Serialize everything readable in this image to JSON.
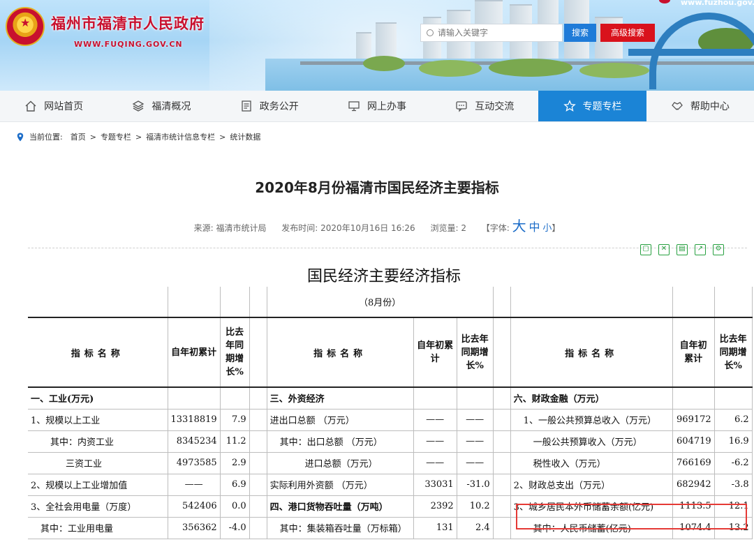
{
  "header": {
    "site_title": "福州市福清市人民政府",
    "site_url": "WWW.FUQING.GOV.CN",
    "top_right_url": "www.fuzhou.gov.cn",
    "search_placeholder": "请输入关键字",
    "search_button": "搜索",
    "advanced_search_button": "高级搜索"
  },
  "nav": {
    "items": [
      {
        "label": "网站首页",
        "icon": "home-icon",
        "active": false
      },
      {
        "label": "福清概况",
        "icon": "layers-icon",
        "active": false
      },
      {
        "label": "政务公开",
        "icon": "document-icon",
        "active": false
      },
      {
        "label": "网上办事",
        "icon": "monitor-icon",
        "active": false
      },
      {
        "label": "互动交流",
        "icon": "chat-icon",
        "active": false
      },
      {
        "label": "专题专栏",
        "icon": "star-icon",
        "active": true
      },
      {
        "label": "帮助中心",
        "icon": "handshake-icon",
        "active": false
      }
    ]
  },
  "breadcrumb": {
    "prefix": "当前位置:",
    "items": [
      "首页",
      "专题专栏",
      "福清市统计信息专栏",
      "统计数据"
    ],
    "separator": ">"
  },
  "article": {
    "title": "2020年8月份福清市国民经济主要指标",
    "source_label": "来源: 福清市统计局",
    "publish_label": "发布时间: 2020年10月16日 16:26",
    "views_label": "浏览量: 2",
    "font_prefix": "【字体:",
    "font_big": "大",
    "font_mid": "中",
    "font_small": "小",
    "font_suffix": "】"
  },
  "sheet": {
    "title": "国民经济主要经济指标",
    "month": "（8月份）",
    "header": {
      "name": "指标名称",
      "cumulative": "自年初累计",
      "growth3": "比去年同期增长%",
      "growth2": "比去年同期增长%"
    },
    "rows": [
      {
        "a_name": "一、工业(万元)",
        "a_val": "",
        "a_pct": "",
        "b_name": "三、外资经济",
        "b_val": "",
        "b_pct": "",
        "c_name": "六、财政金融（万元）",
        "c_val": "",
        "c_pct": ""
      },
      {
        "a_name": "1、规模以上工业",
        "a_val": "13318819",
        "a_pct": "7.9",
        "b_name": "进出口总额 （万元）",
        "b_val": "——",
        "b_pct": "——",
        "c_name": "1、一般公共预算总收入（万元）",
        "c_val": "969172",
        "c_pct": "6.2"
      },
      {
        "a_name": "其中：内资工业",
        "a_val": "8345234",
        "a_pct": "11.2",
        "b_name": "其中：出口总额 （万元）",
        "b_val": "——",
        "b_pct": "——",
        "c_name": "一般公共预算收入（万元）",
        "c_val": "604719",
        "c_pct": "16.9"
      },
      {
        "a_name": "三资工业",
        "a_val": "4973585",
        "a_pct": "2.9",
        "b_name": "进口总额（万元）",
        "b_val": "——",
        "b_pct": "——",
        "c_name": "税性收入（万元）",
        "c_val": "766169",
        "c_pct": "-6.2"
      },
      {
        "a_name": "2、规模以上工业增加值",
        "a_val": "——",
        "a_pct": "6.9",
        "b_name": "实际利用外资额 （万元）",
        "b_val": "33031",
        "b_pct": "-31.0",
        "c_name": "2、财政总支出（万元）",
        "c_val": "682942",
        "c_pct": "-3.8"
      },
      {
        "a_name": "3、全社会用电量（万度）",
        "a_val": "542406",
        "a_pct": "0.0",
        "b_name": "四、港口货物吞吐量（万吨）",
        "b_val": "2392",
        "b_pct": "10.2",
        "c_name": "3、城乡居民本外币储蓄余额(亿元)",
        "c_val": "1113.5",
        "c_pct": "12.1"
      },
      {
        "a_name": "其中：工业用电量",
        "a_val": "356362",
        "a_pct": "-4.0",
        "b_name": "其中：集装箱吞吐量（万标箱）",
        "b_val": "131",
        "b_pct": "2.4",
        "c_name": "其中：人民币储蓄(亿元)",
        "c_val": "1074.4",
        "c_pct": "13.2"
      }
    ]
  },
  "colors": {
    "brand_red": "#c8102e",
    "nav_active": "#1b84d6",
    "search_button": "#1f7bd8",
    "advanced_button": "#d9121c",
    "highlight_border": "#e53935",
    "tool_green": "#27a040"
  }
}
